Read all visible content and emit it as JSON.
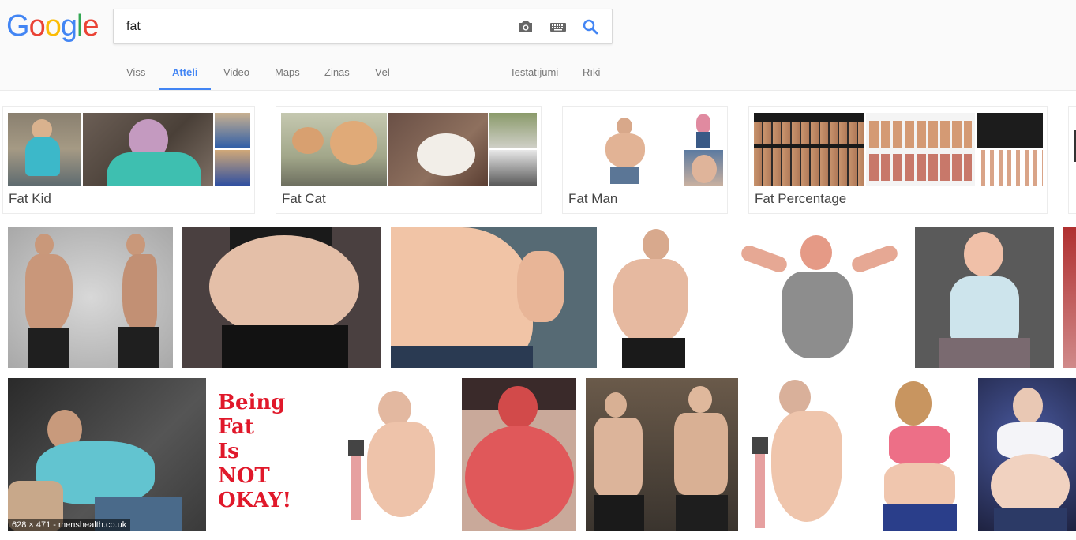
{
  "logo": {
    "letters": [
      "G",
      "o",
      "o",
      "g",
      "l",
      "e"
    ]
  },
  "search": {
    "value": "fat"
  },
  "icons": {
    "camera": "camera-icon",
    "keyboard": "keyboard-icon",
    "search": "search-icon"
  },
  "tabs": [
    {
      "label": "Viss"
    },
    {
      "label": "Attēli"
    },
    {
      "label": "Video"
    },
    {
      "label": "Maps"
    },
    {
      "label": "Ziņas"
    },
    {
      "label": "Vēl"
    },
    {
      "label": "Iestatījumi"
    },
    {
      "label": "Rīki"
    }
  ],
  "related": [
    {
      "label": "Fat Kid"
    },
    {
      "label": "Fat Cat"
    },
    {
      "label": "Fat Man"
    },
    {
      "label": "Fat Percentage"
    }
  ],
  "results": {
    "caption": "628 × 471 - menshealth.co.uk",
    "being_lines": [
      "Being",
      "Fat",
      "Is",
      "NOT",
      "OKAY!"
    ]
  },
  "colors": {
    "accent": "#4285f4",
    "logo": [
      "#4285f4",
      "#ea4335",
      "#fbbc05",
      "#4285f4",
      "#34a853",
      "#ea4335"
    ]
  }
}
